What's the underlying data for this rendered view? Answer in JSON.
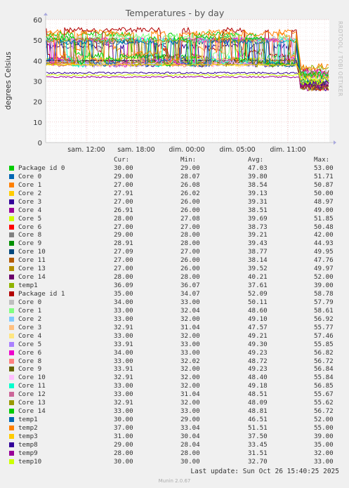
{
  "chart_data": {
    "type": "line",
    "title": "Temperatures - by day",
    "ylabel": "degrees Celsius",
    "ylim": [
      0,
      60
    ],
    "y_ticks": [
      "0",
      "10",
      "20",
      "30",
      "40",
      "50",
      "60"
    ],
    "x_ticks": [
      "sam. 12:00",
      "sam. 18:00",
      "dim. 00:00",
      "dim. 05:00",
      "dim. 11:00"
    ],
    "grid": true,
    "columns": [
      "Cur:",
      "Min:",
      "Avg:",
      "Max:"
    ],
    "series": [
      {
        "name": "Package id 0",
        "color": "#00cc00",
        "cur": "30.00",
        "min": "29.00",
        "avg": "47.03",
        "max": "53.00",
        "lvl": 53,
        "late": 30
      },
      {
        "name": "Core 0",
        "color": "#0066b3",
        "cur": "29.00",
        "min": "28.07",
        "avg": "39.80",
        "max": "51.71",
        "lvl": 40,
        "late": 29
      },
      {
        "name": "Core 1",
        "color": "#ff8000",
        "cur": "27.00",
        "min": "26.08",
        "avg": "38.54",
        "max": "50.87",
        "lvl": 54,
        "late": 27
      },
      {
        "name": "Core 2",
        "color": "#ffcc00",
        "cur": "27.91",
        "min": "26.02",
        "avg": "39.13",
        "max": "50.00",
        "lvl": 38,
        "late": 28
      },
      {
        "name": "Core 3",
        "color": "#330099",
        "cur": "27.00",
        "min": "26.00",
        "avg": "39.31",
        "max": "48.97",
        "lvl": 47,
        "late": 27
      },
      {
        "name": "Core 4",
        "color": "#990099",
        "cur": "26.91",
        "min": "26.00",
        "avg": "38.51",
        "max": "49.00",
        "lvl": 39,
        "late": 27
      },
      {
        "name": "Core 5",
        "color": "#ccff00",
        "cur": "28.00",
        "min": "27.08",
        "avg": "39.69",
        "max": "51.85",
        "lvl": 41,
        "late": 28
      },
      {
        "name": "Core 6",
        "color": "#ff0000",
        "cur": "27.00",
        "min": "27.00",
        "avg": "38.73",
        "max": "50.48",
        "lvl": 40,
        "late": 27
      },
      {
        "name": "Core 8",
        "color": "#808080",
        "cur": "29.00",
        "min": "28.00",
        "avg": "39.21",
        "max": "42.00",
        "lvl": 40,
        "late": 29
      },
      {
        "name": "Core 9",
        "color": "#008f00",
        "cur": "28.91",
        "min": "28.00",
        "avg": "39.43",
        "max": "44.93",
        "lvl": 40,
        "late": 29
      },
      {
        "name": "Core 10",
        "color": "#00487d",
        "cur": "27.09",
        "min": "27.00",
        "avg": "38.77",
        "max": "49.95",
        "lvl": 49,
        "late": 27
      },
      {
        "name": "Core 11",
        "color": "#b35a00",
        "cur": "27.00",
        "min": "26.00",
        "avg": "38.14",
        "max": "47.76",
        "lvl": 39,
        "late": 27
      },
      {
        "name": "Core 13",
        "color": "#b38f00",
        "cur": "27.00",
        "min": "26.00",
        "avg": "39.52",
        "max": "49.97",
        "lvl": 39,
        "late": 27
      },
      {
        "name": "Core 14",
        "color": "#6b006b",
        "cur": "28.00",
        "min": "28.00",
        "avg": "40.21",
        "max": "52.00",
        "lvl": 40,
        "late": 28
      },
      {
        "name": "temp1",
        "color": "#8fb300",
        "cur": "36.09",
        "min": "36.07",
        "avg": "37.61",
        "max": "39.00",
        "lvl": 38,
        "late": 36
      },
      {
        "name": "Package id 1",
        "color": "#b30000",
        "cur": "35.00",
        "min": "34.07",
        "avg": "52.09",
        "max": "58.78",
        "lvl": 55,
        "late": 35
      },
      {
        "name": "Core 0",
        "color": "#bebebe",
        "cur": "34.00",
        "min": "33.00",
        "avg": "50.11",
        "max": "57.79",
        "lvl": 51,
        "late": 34
      },
      {
        "name": "Core 1",
        "color": "#80ff80",
        "cur": "33.00",
        "min": "32.04",
        "avg": "48.60",
        "max": "58.61",
        "lvl": 52,
        "late": 33
      },
      {
        "name": "Core 2",
        "color": "#80c9ff",
        "cur": "33.00",
        "min": "32.00",
        "avg": "49.10",
        "max": "56.92",
        "lvl": 50,
        "late": 33
      },
      {
        "name": "Core 3",
        "color": "#ffc080",
        "cur": "32.91",
        "min": "31.04",
        "avg": "47.57",
        "max": "55.77",
        "lvl": 50,
        "late": 33
      },
      {
        "name": "Core 4",
        "color": "#ffe680",
        "cur": "33.00",
        "min": "32.00",
        "avg": "49.21",
        "max": "57.46",
        "lvl": 50,
        "late": 33
      },
      {
        "name": "Core 5",
        "color": "#aa80ff",
        "cur": "33.91",
        "min": "33.00",
        "avg": "49.30",
        "max": "55.85",
        "lvl": 50,
        "late": 34
      },
      {
        "name": "Core 6",
        "color": "#ee00cc",
        "cur": "34.00",
        "min": "33.00",
        "avg": "49.23",
        "max": "56.82",
        "lvl": 50,
        "late": 34
      },
      {
        "name": "Core 8",
        "color": "#ff8080",
        "cur": "33.00",
        "min": "32.02",
        "avg": "48.72",
        "max": "56.72",
        "lvl": 50,
        "late": 33
      },
      {
        "name": "Core 9",
        "color": "#666600",
        "cur": "33.91",
        "min": "32.00",
        "avg": "49.23",
        "max": "56.84",
        "lvl": 50,
        "late": 34
      },
      {
        "name": "Core 10",
        "color": "#ffbfff",
        "cur": "32.91",
        "min": "32.00",
        "avg": "48.40",
        "max": "55.84",
        "lvl": 50,
        "late": 33
      },
      {
        "name": "Core 11",
        "color": "#00ffcc",
        "cur": "33.00",
        "min": "32.00",
        "avg": "49.18",
        "max": "56.85",
        "lvl": 50,
        "late": 33
      },
      {
        "name": "Core 12",
        "color": "#cc6699",
        "cur": "33.00",
        "min": "31.04",
        "avg": "48.51",
        "max": "55.67",
        "lvl": 50,
        "late": 33
      },
      {
        "name": "Core 13",
        "color": "#999900",
        "cur": "32.91",
        "min": "32.00",
        "avg": "48.09",
        "max": "55.62",
        "lvl": 50,
        "late": 33
      },
      {
        "name": "Core 14",
        "color": "#00cc00",
        "cur": "33.00",
        "min": "33.00",
        "avg": "48.81",
        "max": "56.72",
        "lvl": 51,
        "late": 33
      },
      {
        "name": "temp1",
        "color": "#0066b3",
        "cur": "30.00",
        "min": "29.00",
        "avg": "46.51",
        "max": "52.00",
        "lvl": 49,
        "late": 30
      },
      {
        "name": "temp2",
        "color": "#ff8000",
        "cur": "37.00",
        "min": "33.04",
        "avg": "51.51",
        "max": "55.00",
        "lvl": 53,
        "late": 37
      },
      {
        "name": "temp3",
        "color": "#ffcc00",
        "cur": "31.00",
        "min": "30.04",
        "avg": "37.50",
        "max": "39.00",
        "lvl": 38,
        "late": 31
      },
      {
        "name": "temp8",
        "color": "#330099",
        "cur": "29.00",
        "min": "28.04",
        "avg": "33.45",
        "max": "35.00",
        "lvl": 34,
        "late": 29
      },
      {
        "name": "temp9",
        "color": "#990099",
        "cur": "28.00",
        "min": "28.00",
        "avg": "31.51",
        "max": "32.00",
        "lvl": 32,
        "late": 28
      },
      {
        "name": "temp10",
        "color": "#ccff00",
        "cur": "30.00",
        "min": "30.00",
        "avg": "32.70",
        "max": "33.00",
        "lvl": 33,
        "late": 30
      }
    ]
  },
  "footer": {
    "last_update": "Last update:  Sun Oct 26 15:40:25 2025",
    "munin_version": "Munin 2.0.67",
    "rrd_label": "RRDTOOL / TOBI OETIKER"
  }
}
